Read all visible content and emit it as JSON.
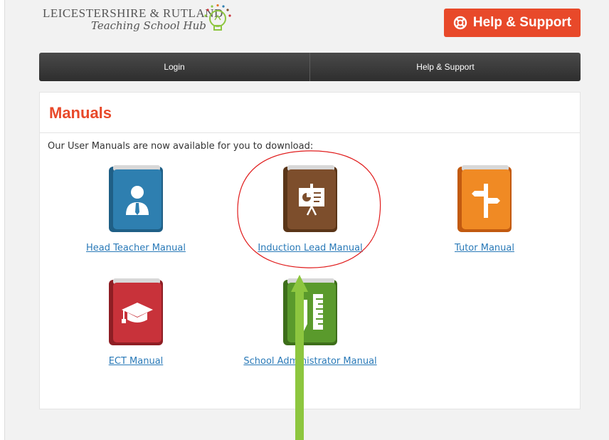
{
  "header": {
    "logo_line1": "LEICESTERSHIRE & RUTLAND",
    "logo_line2": "Teaching School Hub",
    "help_button_label": "Help & Support"
  },
  "nav": {
    "items": [
      {
        "label": "Login"
      },
      {
        "label": "Help & Support"
      }
    ]
  },
  "panel": {
    "title": "Manuals",
    "intro": "Our User Manuals are now available for you to download:"
  },
  "manuals": [
    {
      "label": "Head Teacher Manual",
      "icon": "person-icon",
      "color": "#2e7fb0"
    },
    {
      "label": "Induction Lead Manual",
      "icon": "presentation-board-icon",
      "color": "#7d4e2c"
    },
    {
      "label": "Tutor Manual",
      "icon": "signpost-icon",
      "color": "#e8731e"
    },
    {
      "label": "ECT Manual",
      "icon": "graduation-cap-icon",
      "color": "#c8323a"
    },
    {
      "label": "School Administrator Manual",
      "icon": "ruler-pencil-icon",
      "color": "#5a9a2c"
    }
  ],
  "colors": {
    "accent": "#e8492a",
    "link": "#2a7ab8",
    "annotation_circle": "#e01b1b",
    "annotation_arrow": "#8dc63f"
  }
}
